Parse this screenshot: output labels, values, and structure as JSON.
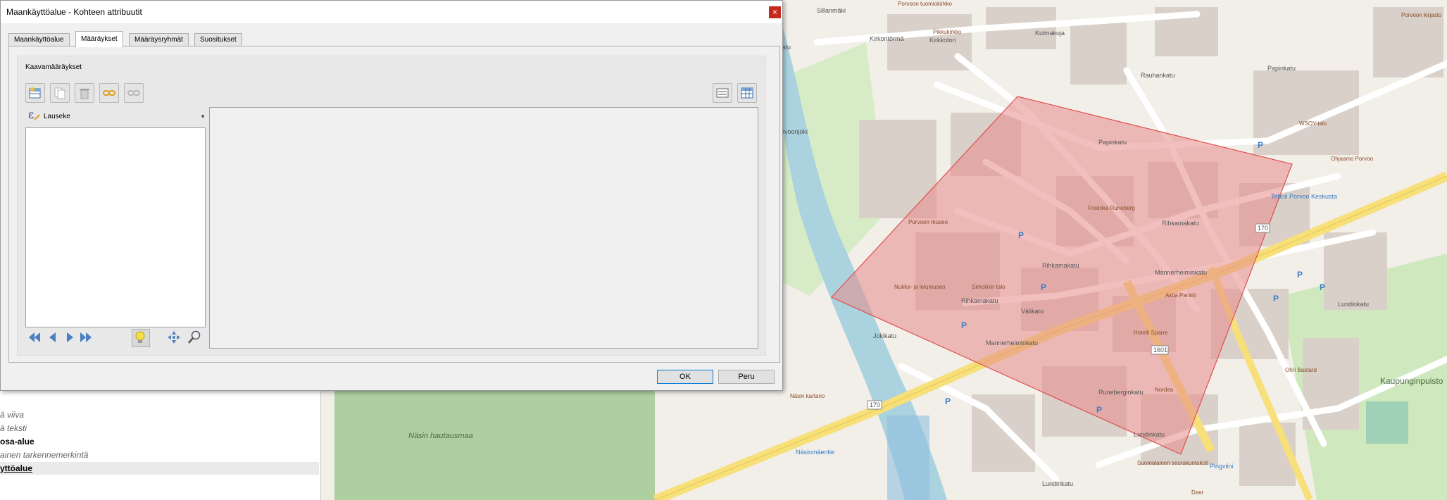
{
  "dialog": {
    "title": "Maankäyttöalue - Kohteen attribuutit",
    "tabs": [
      "Maankäyttöalue",
      "Määräykset",
      "Määräysryhmät",
      "Suositukset"
    ],
    "active_tab": "Määräykset",
    "group_title": "Kaavamääräykset",
    "expression_label": "Lauseke",
    "ok_label": "OK",
    "cancel_label": "Peru"
  },
  "layers_panel": {
    "items": [
      {
        "label": "ä viiva",
        "style": "italic"
      },
      {
        "label": "ä teksti",
        "style": "italic"
      },
      {
        "label": "osa-alue",
        "style": "bold"
      },
      {
        "label": "ainen tarkennemerkintä",
        "style": "italic"
      },
      {
        "label": "yttöalue",
        "style": "bold-underline-selected"
      }
    ]
  },
  "map": {
    "labels": {
      "porvoon_tuomiokirkko": "Porvoon tuomiokirkko",
      "pikkukirkko": "Pikkukirkko",
      "sillanmaki": "Sillanmäki",
      "kirkkotori": "Kirkkotori",
      "kirkontorma": "Kirkontörmä",
      "kulmakuja": "Kulmakuja",
      "kirkkokatu": "Kirkkokatu",
      "jokikatu": "Jokikatu",
      "papinkatu": "Papinkatu",
      "rauhankatu": "Rauhankatu",
      "ws0y_talo": "WSOY-talo",
      "porvoon_kirjasto": "Porvoon kirjasto",
      "ohjaamo": "Ohjaamo Porvoo",
      "runeberg": "Fredrika Runeberg",
      "porvoon_museo": "Porvoon museo",
      "nukke": "Nukke- ja lelumuseo",
      "simolinin_talo": "Simolinin talo",
      "rihkamakatu": "Rihkamakatu",
      "valikatu": "Välikatu",
      "mannerheiminkatu": "Mannerheiminkatu",
      "aktia": "Aktia Pankki",
      "hotelli": "Hotelli Sparre",
      "nordea": "Nordea",
      "lundinkatu": "Lundinkatu",
      "nasin_kartano": "Näsin kartano",
      "nasin_hautausmaa": "Näsin hautausmaa",
      "nasinmaentie": "Näsinmäentie",
      "kaupunginpuisto": "Kaupunginpuisto",
      "seurakuntakoti": "Suomalainen seurakuntakoti",
      "teboil": "Teboil Porvoo Keskusta",
      "ohri_bastard": "Ohri Bastard",
      "pingviini": "Pingviini",
      "deer": "Deer",
      "road_170": "170",
      "road_1601": "1601",
      "porvoonjoki": "Porvoonjoki",
      "runebergin": "Runeberginkatu"
    }
  },
  "colors": {
    "polygon_fill": "#e88a8a",
    "polygon_stroke": "#e05050",
    "river": "#aad3df",
    "park": "#c8e6b0",
    "cemetery": "#aecfa0",
    "ok_border": "#0078d7",
    "close_button": "#c42b1c"
  }
}
